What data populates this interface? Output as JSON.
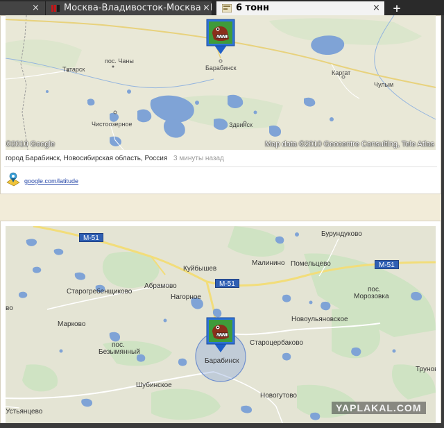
{
  "browser": {
    "tabs": [
      {
        "title": "Москва-Владивосток-Москва - П...",
        "active": false
      },
      {
        "title": "6 тонн",
        "active": true
      }
    ],
    "new_tab_glyph": "+",
    "close_glyph": "×"
  },
  "post_top": {
    "map_labels": {
      "tatarsk": "Татарск",
      "chany": "пос. Чаны",
      "barabinsk": "Барабинск",
      "kargat": "Каргат",
      "chulym": "Чулым",
      "chistoozernoe": "Чистоозерное",
      "zdvinsk": "Здвинск"
    },
    "copyright_left": "©2010 Google",
    "copyright_right": "Map data ©2010 Geocentre Consulting, Tele Atlas",
    "location_text": "город Барабинск, Новосибирская область, Россия",
    "timestamp": "3 минуты назад",
    "footer_link": "google.com/latitude"
  },
  "post_bottom": {
    "map_labels": {
      "burundukovo": "Бурундуково",
      "kuibyshev": "Куйбышев",
      "malinino": "Малинино",
      "pomeltsevo": "Помельцево",
      "abramovo": "Абрамово",
      "starogrebentsikovo": "Старогребенщиково",
      "nagornoe": "Нагорное",
      "morozovka_pos": "пос.",
      "morozovka": "Морозовка",
      "novoulyanovskoe": "Новоульяновское",
      "markovo": "Марково",
      "starotserbakovo": "Староцербаково",
      "bezymyanny_pos": "пос.",
      "bezymyanny": "Безымянный",
      "barabinsk": "Барабинск",
      "trunovo": "Трунов",
      "shubinskoe": "Шубинское",
      "novogutovo": "Новогутово",
      "ustyantsevo": "Устьянцево",
      "left_cut": "во"
    },
    "road_m51": "M-51"
  },
  "watermark": "YAPLAKAL.COM",
  "colors": {
    "road_yellow": "#f2dd7a",
    "water_blue": "#7fa3d6",
    "forest_green": "#cfe3c3",
    "shield_blue": "#2f5fb3",
    "link_blue": "#2445a8"
  },
  "icons": [
    "tab-favicon-icon",
    "tab-close-icon",
    "new-tab-icon",
    "dog-avatar-icon",
    "map-pin-icon",
    "latitude-badge-icon"
  ]
}
